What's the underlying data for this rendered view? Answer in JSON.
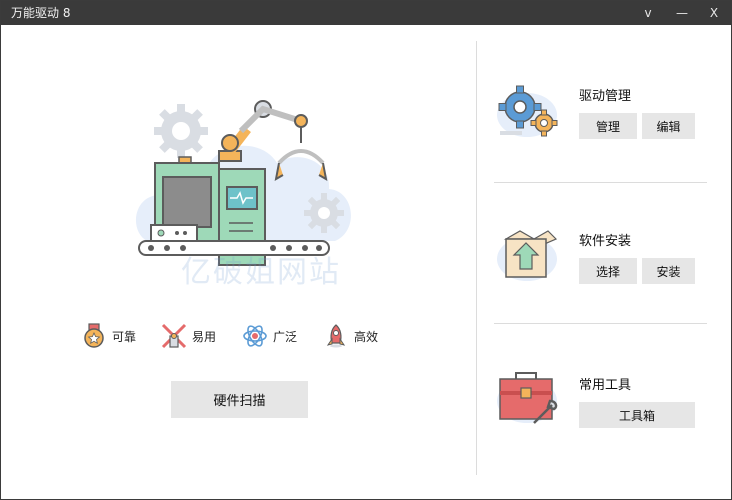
{
  "window": {
    "title": "万能驱动 8",
    "dropdown_glyph": "v",
    "minimize_glyph": "—",
    "close_glyph": "X"
  },
  "watermark": "亿破姐网站",
  "features": [
    {
      "label": "可靠",
      "icon": "medal-icon"
    },
    {
      "label": "易用",
      "icon": "windmill-icon"
    },
    {
      "label": "广泛",
      "icon": "atom-icon"
    },
    {
      "label": "高效",
      "icon": "rocket-icon"
    }
  ],
  "scan_button": "硬件扫描",
  "cards": {
    "driver": {
      "title": "驱动管理",
      "buttons": [
        "管理",
        "编辑"
      ],
      "icon": "gears-icon"
    },
    "software": {
      "title": "软件安装",
      "buttons": [
        "选择",
        "安装"
      ],
      "icon": "box-icon"
    },
    "tools": {
      "title": "常用工具",
      "buttons": [
        "工具箱"
      ],
      "icon": "toolbox-icon"
    }
  },
  "colors": {
    "titlebar": "#3a3a3a",
    "button_bg": "#e6e6e6",
    "accent_green": "#9ed9b8",
    "accent_orange": "#f4b45a",
    "accent_blue": "#5b9bd5",
    "accent_red": "#e56b6b"
  }
}
